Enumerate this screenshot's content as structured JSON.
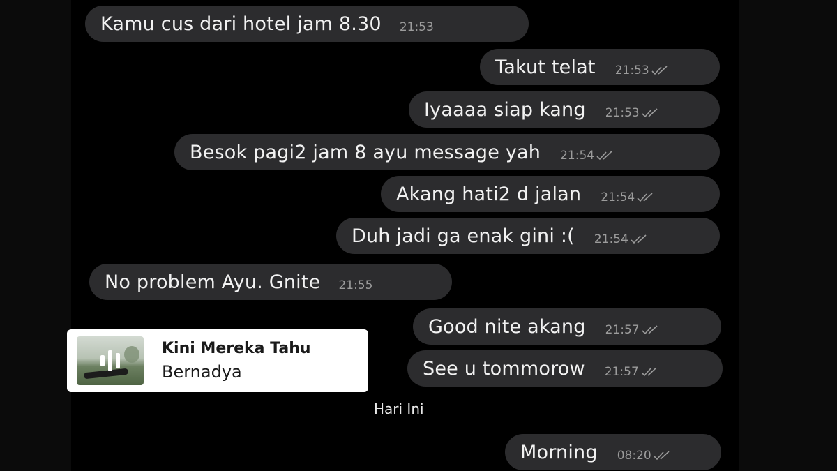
{
  "messages": [
    {
      "text": "Kamu cus dari hotel jam 8.30",
      "time": "21:53",
      "direction": "in",
      "read": false
    },
    {
      "text": "Takut telat",
      "time": "21:53",
      "direction": "out",
      "read": true
    },
    {
      "text": "Iyaaaa siap kang",
      "time": "21:53",
      "direction": "out",
      "read": true
    },
    {
      "text": "Besok pagi2 jam 8 ayu message yah",
      "time": "21:54",
      "direction": "out",
      "read": true
    },
    {
      "text": "Akang hati2 d jalan",
      "time": "21:54",
      "direction": "out",
      "read": true
    },
    {
      "text": "Duh jadi ga enak gini :(",
      "time": "21:54",
      "direction": "out",
      "read": true
    },
    {
      "text": "No problem Ayu. Gnite",
      "time": "21:55",
      "direction": "in",
      "read": false
    },
    {
      "text": "Good nite akang",
      "time": "21:57",
      "direction": "out",
      "read": true
    },
    {
      "text": "See u tommorow",
      "time": "21:57",
      "direction": "out",
      "read": true
    },
    {
      "text": "Morning",
      "time": "08:20",
      "direction": "out",
      "read": true
    }
  ],
  "music_card": {
    "title": "Kini Mereka Tahu",
    "artist": "Bernadya",
    "icon": "audio-wave-icon"
  },
  "date_separator": "Hari Ini",
  "colors": {
    "background": "#000000",
    "bubble": "#2c2c2e",
    "text": "#f2f2f2",
    "meta": "#9c9c9c",
    "card": "#ffffff"
  }
}
